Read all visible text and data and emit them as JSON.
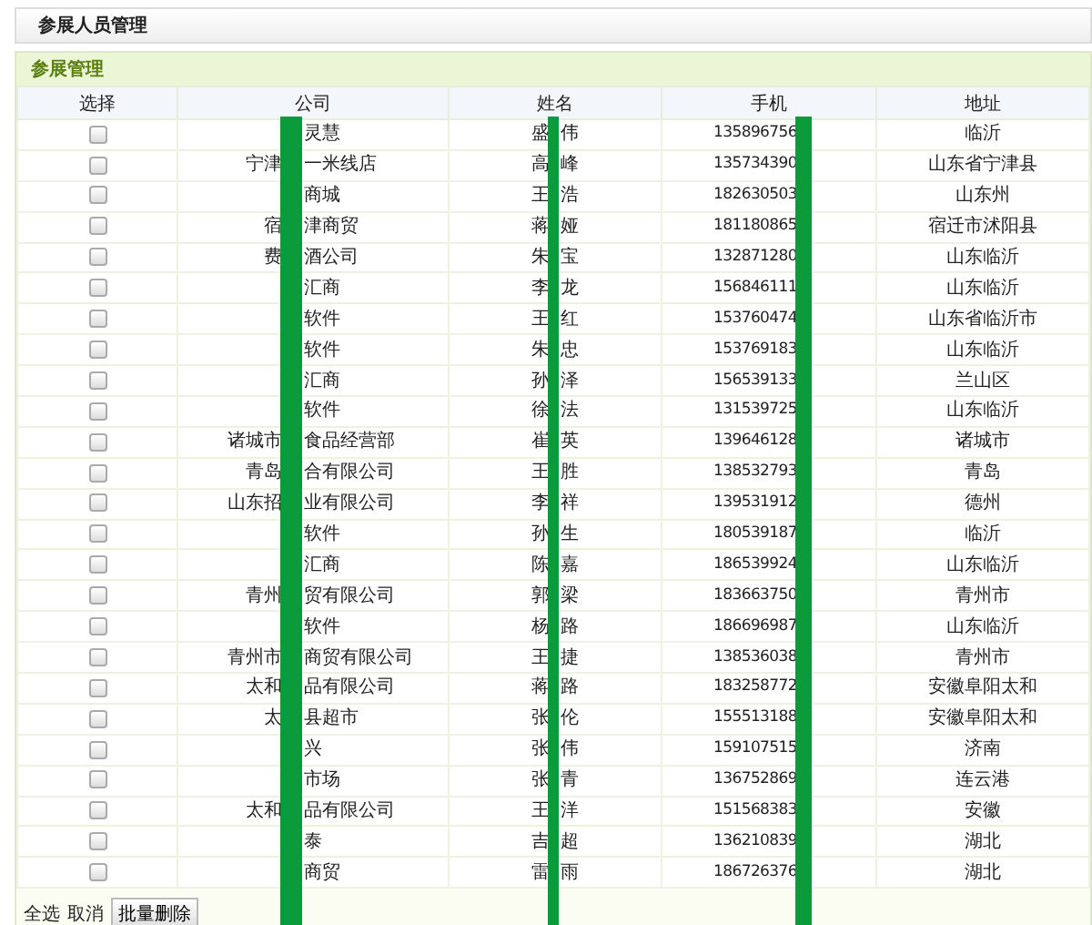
{
  "page_title": "参展人员管理",
  "panel_title": "参展管理",
  "columns": [
    "选择",
    "公司",
    "姓名",
    "手机",
    "地址"
  ],
  "rows": [
    {
      "checked": false,
      "company_left": "",
      "company_right": "灵慧",
      "name_left": "盛",
      "name_right": "伟",
      "phone": "135896756",
      "address": "临沂"
    },
    {
      "checked": false,
      "company_left": "宁津",
      "company_right": "一米线店",
      "name_left": "高",
      "name_right": "峰",
      "phone": "135734390",
      "address": "山东省宁津县"
    },
    {
      "checked": false,
      "company_left": "",
      "company_right": "商城",
      "name_left": "王",
      "name_right": "浩",
      "phone": "182630503",
      "address": "山东州"
    },
    {
      "checked": false,
      "company_left": "宿",
      "company_right": "津商贸",
      "name_left": "蒋",
      "name_right": "娅",
      "phone": "181180865",
      "address": "宿迁市沭阳县"
    },
    {
      "checked": false,
      "company_left": "费",
      "company_right": "酒公司",
      "name_left": "朱",
      "name_right": "宝",
      "phone": "132871280",
      "address": "山东临沂"
    },
    {
      "checked": false,
      "company_left": "",
      "company_right": "汇商",
      "name_left": "李",
      "name_right": "龙",
      "phone": "156846111",
      "address": "山东临沂"
    },
    {
      "checked": false,
      "company_left": "",
      "company_right": "软件",
      "name_left": "王",
      "name_right": "红",
      "phone": "153760474",
      "address": "山东省临沂市"
    },
    {
      "checked": false,
      "company_left": "",
      "company_right": "软件",
      "name_left": "朱",
      "name_right": "忠",
      "phone": "153769183",
      "address": "山东临沂"
    },
    {
      "checked": false,
      "company_left": "",
      "company_right": "汇商",
      "name_left": "孙",
      "name_right": "泽",
      "phone": "156539133",
      "address": "兰山区"
    },
    {
      "checked": false,
      "company_left": "",
      "company_right": "软件",
      "name_left": "徐",
      "name_right": "法",
      "phone": "131539725",
      "address": "山东临沂"
    },
    {
      "checked": false,
      "company_left": "诸城市",
      "company_right": "食品经营部",
      "name_left": "崔",
      "name_right": "英",
      "phone": "139646128",
      "address": "诸城市"
    },
    {
      "checked": false,
      "company_left": "青岛",
      "company_right": "合有限公司",
      "name_left": "王",
      "name_right": "胜",
      "phone": "138532793",
      "address": "青岛"
    },
    {
      "checked": false,
      "company_left": "山东招",
      "company_right": "业有限公司",
      "name_left": "李",
      "name_right": "祥",
      "phone": "139531912",
      "address": "德州"
    },
    {
      "checked": false,
      "company_left": "",
      "company_right": "软件",
      "name_left": "孙",
      "name_right": "生",
      "phone": "180539187",
      "address": "临沂"
    },
    {
      "checked": false,
      "company_left": "",
      "company_right": "汇商",
      "name_left": "陈",
      "name_right": "嘉",
      "phone": "186539924",
      "address": "山东临沂"
    },
    {
      "checked": false,
      "company_left": "青州",
      "company_right": "贸有限公司",
      "name_left": "郭",
      "name_right": "梁",
      "phone": "183663750",
      "address": "青州市"
    },
    {
      "checked": false,
      "company_left": "",
      "company_right": "软件",
      "name_left": "杨",
      "name_right": "路",
      "phone": "186696987",
      "address": "山东临沂"
    },
    {
      "checked": false,
      "company_left": "青州市",
      "company_right": "商贸有限公司",
      "name_left": "王",
      "name_right": "捷",
      "phone": "138536038",
      "address": "青州市"
    },
    {
      "checked": false,
      "company_left": "太和",
      "company_right": "品有限公司",
      "name_left": "蒋",
      "name_right": "路",
      "phone": "183258772",
      "address": "安徽阜阳太和"
    },
    {
      "checked": false,
      "company_left": "太",
      "company_right": "县超市",
      "name_left": "张",
      "name_right": "伦",
      "phone": "155513188",
      "address": "安徽阜阳太和"
    },
    {
      "checked": false,
      "company_left": "",
      "company_right": "兴",
      "name_left": "张",
      "name_right": "伟",
      "phone": "159107515",
      "address": "济南"
    },
    {
      "checked": false,
      "company_left": "",
      "company_right": "市场",
      "name_left": "张",
      "name_right": "青",
      "phone": "136752869",
      "address": "连云港"
    },
    {
      "checked": false,
      "company_left": "太和",
      "company_right": "品有限公司",
      "name_left": "王",
      "name_right": "洋",
      "phone": "151568383",
      "address": "安徽"
    },
    {
      "checked": false,
      "company_left": "",
      "company_right": "泰",
      "name_left": "吉",
      "name_right": "超",
      "phone": "136210839",
      "address": "湖北"
    },
    {
      "checked": false,
      "company_left": "",
      "company_right": "商贸",
      "name_left": "雷",
      "name_right": "雨",
      "phone": "186726376",
      "address": "湖北"
    }
  ],
  "footer": {
    "select_all": "全选",
    "cancel": "取消",
    "batch_delete": "批量删除"
  }
}
